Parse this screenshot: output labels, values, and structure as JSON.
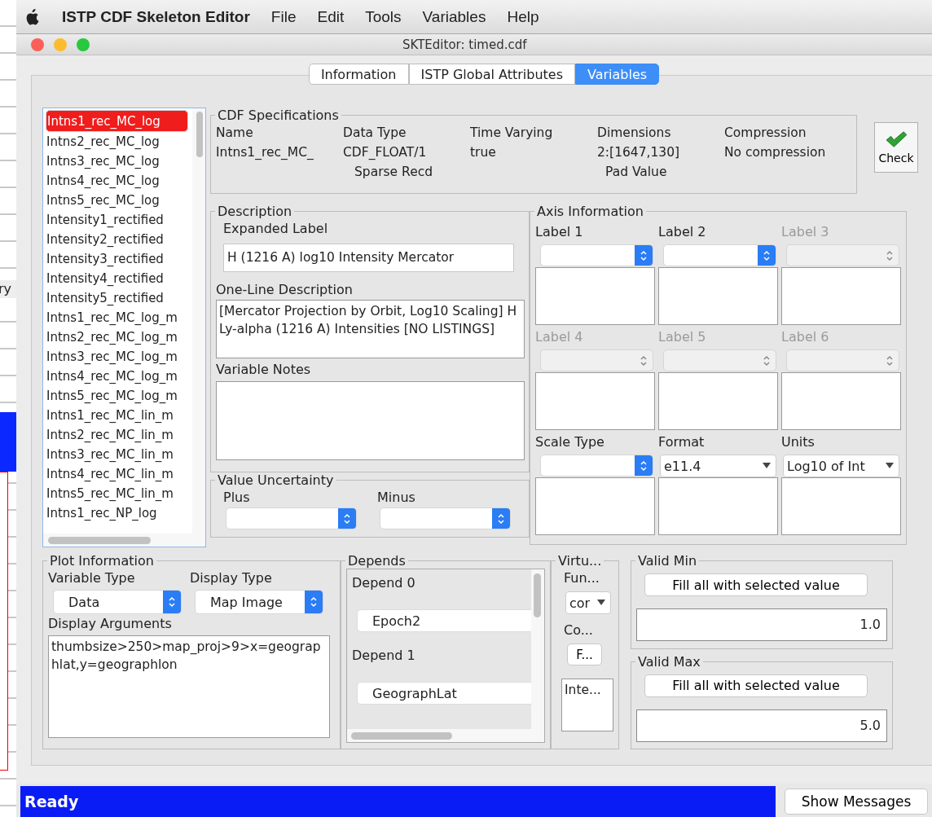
{
  "background_window": {
    "label": "ry"
  },
  "menu_bar": {
    "app_name": "ISTP CDF Skeleton Editor",
    "items": [
      "File",
      "Edit",
      "Tools",
      "Variables",
      "Help"
    ]
  },
  "window": {
    "title": "SKTEditor: timed.cdf"
  },
  "tabs": [
    {
      "label": "Information",
      "selected": false
    },
    {
      "label": "ISTP Global Attributes",
      "selected": false
    },
    {
      "label": "Variables",
      "selected": true
    }
  ],
  "variable_list": [
    {
      "name": "Intns1_rec_MC_log",
      "selected": true
    },
    {
      "name": "Intns2_rec_MC_log",
      "selected": false
    },
    {
      "name": "Intns3_rec_MC_log",
      "selected": false
    },
    {
      "name": "Intns4_rec_MC_log",
      "selected": false
    },
    {
      "name": "Intns5_rec_MC_log",
      "selected": false
    },
    {
      "name": "Intensity1_rectified",
      "selected": false
    },
    {
      "name": "Intensity2_rectified",
      "selected": false
    },
    {
      "name": "Intensity3_rectified",
      "selected": false
    },
    {
      "name": "Intensity4_rectified",
      "selected": false
    },
    {
      "name": "Intensity5_rectified",
      "selected": false
    },
    {
      "name": "Intns1_rec_MC_log_m",
      "selected": false
    },
    {
      "name": "Intns2_rec_MC_log_m",
      "selected": false
    },
    {
      "name": "Intns3_rec_MC_log_m",
      "selected": false
    },
    {
      "name": "Intns4_rec_MC_log_m",
      "selected": false
    },
    {
      "name": "Intns5_rec_MC_log_m",
      "selected": false
    },
    {
      "name": "Intns1_rec_MC_lin_m",
      "selected": false
    },
    {
      "name": "Intns2_rec_MC_lin_m",
      "selected": false
    },
    {
      "name": "Intns3_rec_MC_lin_m",
      "selected": false
    },
    {
      "name": "Intns4_rec_MC_lin_m",
      "selected": false
    },
    {
      "name": "Intns5_rec_MC_lin_m",
      "selected": false
    },
    {
      "name": "Intns1_rec_NP_log",
      "selected": false
    }
  ],
  "cdf_specifications": {
    "title": "CDF Specifications",
    "columns": [
      {
        "label": "Name",
        "value": "Intns1_rec_MC_"
      },
      {
        "label": "Data Type",
        "value": "CDF_FLOAT/1"
      },
      {
        "label": "Time Varying",
        "value": "true"
      },
      {
        "label": "Dimensions",
        "value": "2:[1647,130]"
      },
      {
        "label": "Compression",
        "value": "No compression"
      }
    ],
    "sparse_record": {
      "label": "Sparse Recd"
    },
    "pad_value": {
      "label": "Pad Value"
    }
  },
  "check_button": {
    "label": "Check"
  },
  "description": {
    "title": "Description",
    "expanded_label": {
      "label": "Expanded Label",
      "value": "H (1216 A) log10 Intensity Mercator"
    },
    "one_line_description": {
      "label": "One-Line Description",
      "value": "[Mercator Projection by Orbit, Log10 Scaling] H Ly-alpha (1216 A) Intensities [NO LISTINGS]"
    },
    "variable_notes": {
      "label": "Variable Notes"
    }
  },
  "value_uncertainty": {
    "title": "Value Uncertainty",
    "fields": [
      {
        "label": "Plus"
      },
      {
        "label": "Minus"
      }
    ]
  },
  "axis_information": {
    "title": "Axis Information",
    "cells": [
      {
        "label": "Label 1",
        "kind": "select",
        "disabled": false
      },
      {
        "label": "Label 2",
        "kind": "select",
        "disabled": false
      },
      {
        "label": "Label 3",
        "kind": "select",
        "disabled": true
      },
      {
        "label": "Label 4",
        "kind": "select",
        "disabled": true
      },
      {
        "label": "Label 5",
        "kind": "select",
        "disabled": true
      },
      {
        "label": "Label 6",
        "kind": "select",
        "disabled": true
      },
      {
        "label": "Scale Type",
        "kind": "select",
        "disabled": false
      },
      {
        "label": "Format",
        "kind": "combo",
        "disabled": false,
        "value": "e11.4"
      },
      {
        "label": "Units",
        "kind": "combo",
        "disabled": false,
        "value": "Log10 of Int"
      }
    ]
  },
  "plot_information": {
    "title": "Plot Information",
    "variable_type": {
      "label": "Variable Type",
      "value": "Data"
    },
    "display_type": {
      "label": "Display Type",
      "value": "Map Image"
    },
    "display_arguments": {
      "label": "Display Arguments",
      "value": "thumbsize>250>map_proj>9>x=geographlat,y=geographlon"
    }
  },
  "depends": {
    "title": "Depends",
    "items": [
      {
        "label": "Depend 0",
        "value": "Epoch2"
      },
      {
        "label": "Depend 1",
        "value": "GeographLat"
      }
    ]
  },
  "virtual": {
    "title": "Virtu...",
    "function_label": "Fun...",
    "function_value": "cor",
    "component_label": "Co...",
    "component_button": "F...",
    "component_value": "Inte..."
  },
  "valid_min": {
    "title": "Valid Min",
    "button": "Fill all with selected value",
    "value": "1.0"
  },
  "valid_max": {
    "title": "Valid Max",
    "button": "Fill all with selected value",
    "value": "5.0"
  },
  "status_bar": {
    "text": "Ready",
    "button": "Show Messages"
  }
}
